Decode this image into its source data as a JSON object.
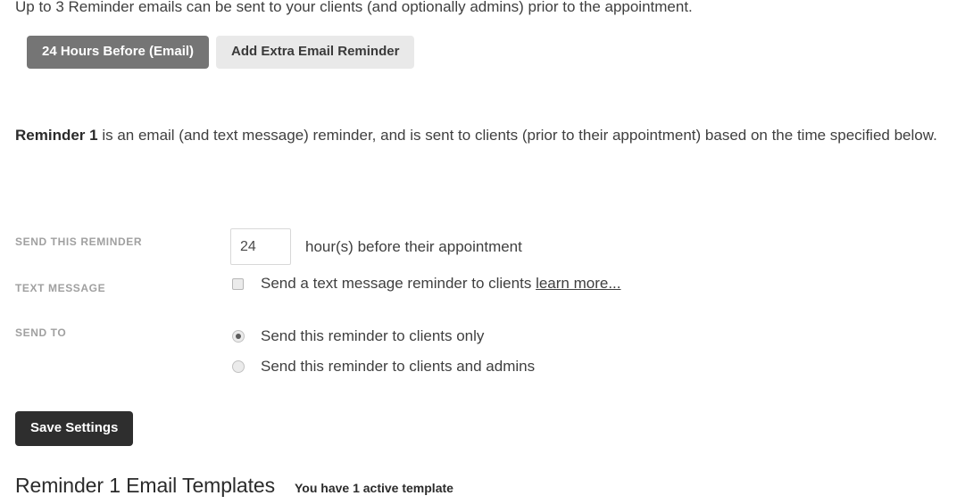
{
  "intro": {
    "text": "Up to 3 Reminder emails can be sent to your clients (and optionally admins) prior to the appointment."
  },
  "tabs": [
    {
      "label": "24 Hours Before (Email)",
      "active": true
    },
    {
      "label": "Add Extra Email Reminder",
      "active": false
    }
  ],
  "description": {
    "bold_prefix": "Reminder 1",
    "rest": " is an email (and text message) reminder, and is sent to clients (prior to their appointment) based on the time specified below."
  },
  "form": {
    "send_this_reminder": {
      "label": "SEND THIS REMINDER",
      "value": "24",
      "placeholder": "24",
      "suffix": "hour(s) before their appointment"
    },
    "text_message": {
      "label": "TEXT MESSAGE",
      "checked": false,
      "option_text": "Send a text message reminder to clients",
      "link_text": "learn more..."
    },
    "send_to": {
      "label": "SEND TO",
      "options": [
        {
          "label": "Send this reminder to clients only",
          "selected": true
        },
        {
          "label": "Send this reminder to clients and admins",
          "selected": false
        }
      ]
    }
  },
  "save_button": {
    "label": "Save Settings"
  },
  "templates_section": {
    "title": "Reminder 1 Email Templates",
    "subtitle": "You have 1 active template"
  },
  "colors": {
    "active_tab_bg": "#757575",
    "inactive_tab_bg": "#e9e9e9",
    "save_button_bg": "#2e2e2e",
    "label_text": "#a0a0a0",
    "body_text": "#3f3f3f"
  }
}
